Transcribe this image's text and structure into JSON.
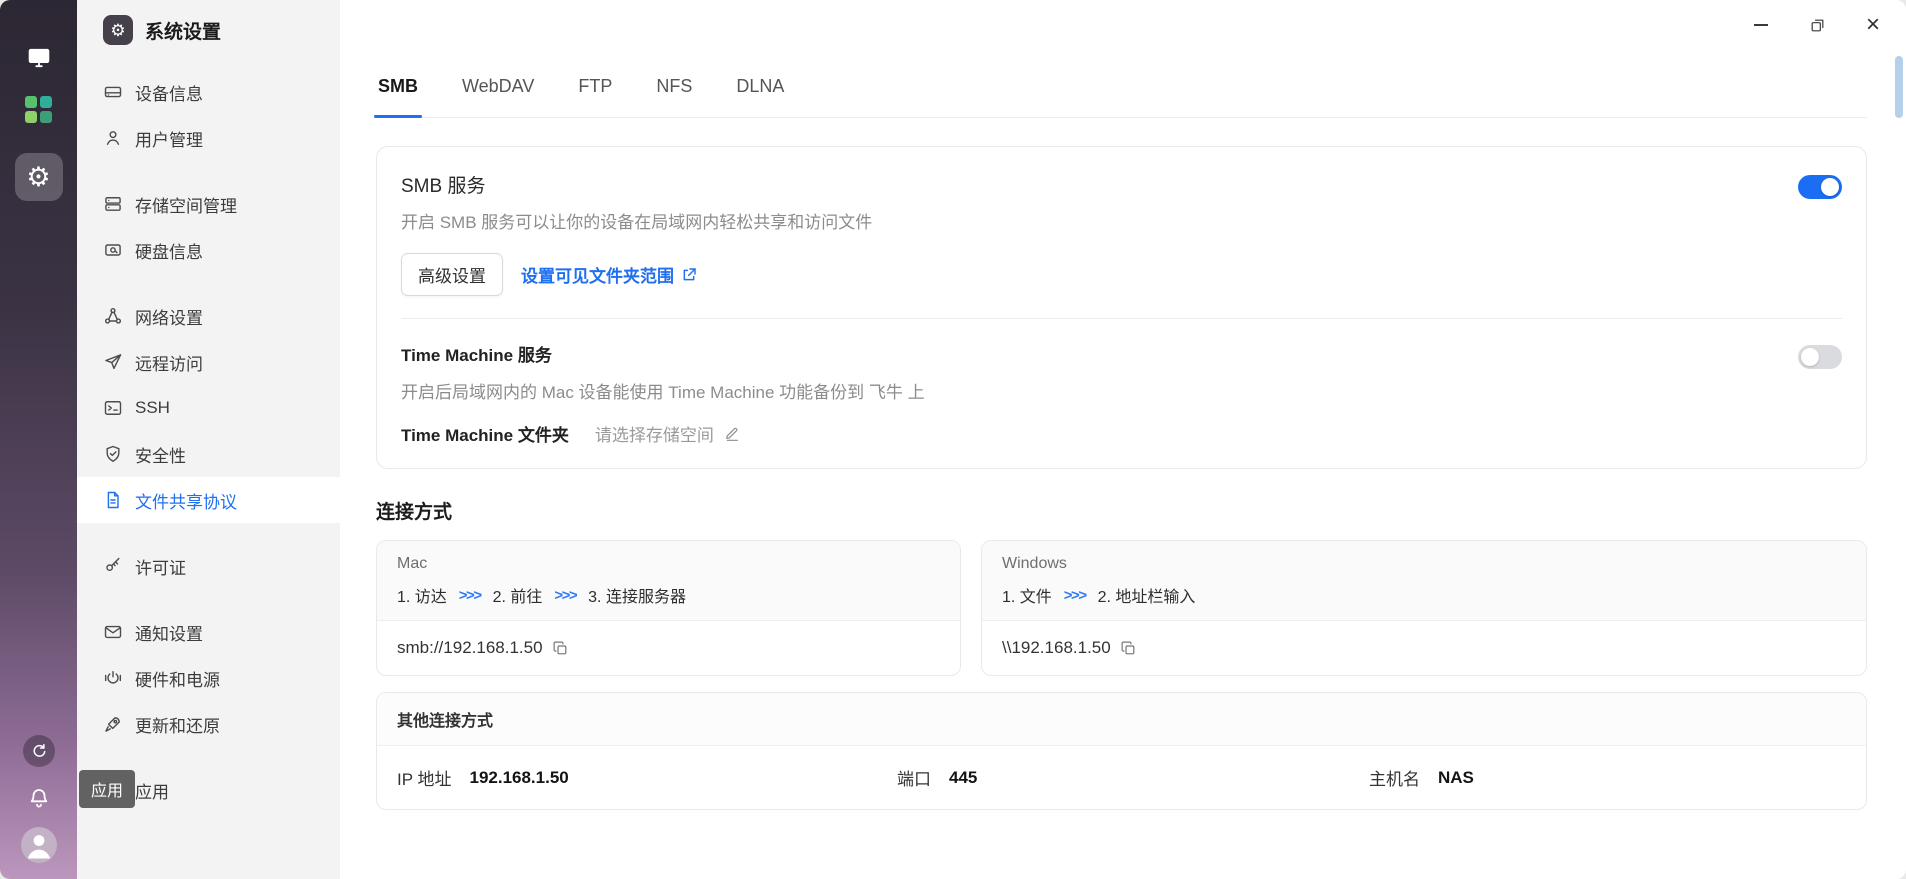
{
  "window": {
    "title": "系统设置"
  },
  "icons": {
    "gear": "⚙"
  },
  "rail": {
    "tooltip": "应用"
  },
  "sidebar": {
    "title": "系统设置",
    "items": [
      {
        "icon": "device-info-icon",
        "label": "设备信息"
      },
      {
        "icon": "user-icon",
        "label": "用户管理"
      },
      {
        "icon": "storage-icon",
        "label": "存储空间管理"
      },
      {
        "icon": "disk-icon",
        "label": "硬盘信息"
      },
      {
        "icon": "network-icon",
        "label": "网络设置"
      },
      {
        "icon": "remote-icon",
        "label": "远程访问"
      },
      {
        "icon": "terminal-icon",
        "label": "SSH"
      },
      {
        "icon": "shield-icon",
        "label": "安全性"
      },
      {
        "icon": "file-share-icon",
        "label": "文件共享协议"
      },
      {
        "icon": "key-icon",
        "label": "许可证"
      },
      {
        "icon": "mail-icon",
        "label": "通知设置"
      },
      {
        "icon": "power-icon",
        "label": "硬件和电源"
      },
      {
        "icon": "rocket-icon",
        "label": "更新和还原"
      },
      {
        "icon": "apps-icon",
        "label": "应用"
      }
    ]
  },
  "tabs": [
    {
      "label": "SMB",
      "active": true
    },
    {
      "label": "WebDAV"
    },
    {
      "label": "FTP"
    },
    {
      "label": "NFS"
    },
    {
      "label": "DLNA"
    }
  ],
  "smb": {
    "service_title": "SMB 服务",
    "service_desc": "开启 SMB 服务可以让你的设备在局域网内轻松共享和访问文件",
    "service_enabled": true,
    "advanced_button": "高级设置",
    "scope_link": "设置可见文件夹范围",
    "tm_title": "Time Machine 服务",
    "tm_enabled": false,
    "tm_desc": "开启后局域网内的 Mac 设备能使用 Time Machine 功能备份到 飞牛 上",
    "tm_folder_label": "Time Machine 文件夹",
    "tm_folder_placeholder": "请选择存储空间"
  },
  "connection": {
    "section_title": "连接方式",
    "arrow": ">>>",
    "mac": {
      "name": "Mac",
      "steps": [
        "1. 访达",
        "2. 前往",
        "3. 连接服务器"
      ],
      "address": "smb://192.168.1.50"
    },
    "windows": {
      "name": "Windows",
      "steps": [
        "1. 文件",
        "2. 地址栏输入"
      ],
      "address": "\\\\192.168.1.50"
    },
    "other": {
      "title": "其他连接方式",
      "ip_label": "IP 地址",
      "ip_value": "192.168.1.50",
      "port_label": "端口",
      "port_value": "445",
      "host_label": "主机名",
      "host_value": "NAS"
    }
  },
  "colors": {
    "accent": "#1f6ff2",
    "toggle_on": "#1b6ef3",
    "toggle_off": "#d9dbdf",
    "scroll_thumb": "#b5d0eb"
  }
}
